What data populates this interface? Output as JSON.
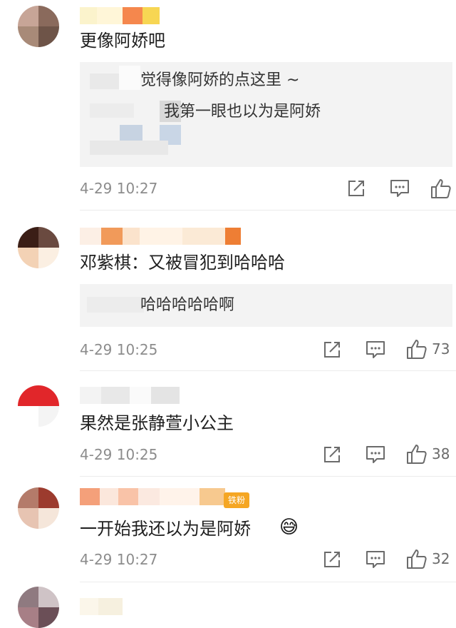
{
  "comments": [
    {
      "id": "c1",
      "text": "更像阿娇吧",
      "reply_lines": [
        "觉得像阿娇的点这里 ~",
        "我第一眼也以为是阿娇"
      ],
      "time": "4-29 10:27",
      "likes": ""
    },
    {
      "id": "c2",
      "text": "邓紫棋：又被冒犯到哈哈哈",
      "reply_lines": [
        "哈哈哈哈哈啊"
      ],
      "time": "4-29 10:25",
      "likes": "73"
    },
    {
      "id": "c3",
      "text": "果然是张静萱小公主",
      "reply_lines": [],
      "time": "4-29 10:25",
      "likes": "38"
    },
    {
      "id": "c4",
      "text": "一开始我还以为是阿娇",
      "badge": "铁粉",
      "reply_lines": [],
      "time": "4-29 10:27",
      "likes": "32"
    }
  ],
  "icons": {
    "share": "share-icon",
    "comment": "comment-icon",
    "like": "thumbs-up-icon",
    "emoji": "sweat-smile-emoji-icon"
  },
  "colors": {
    "meta_text": "#8c8c8c",
    "reply_bg": "#f3f3f3",
    "badge": "#f5a623"
  }
}
